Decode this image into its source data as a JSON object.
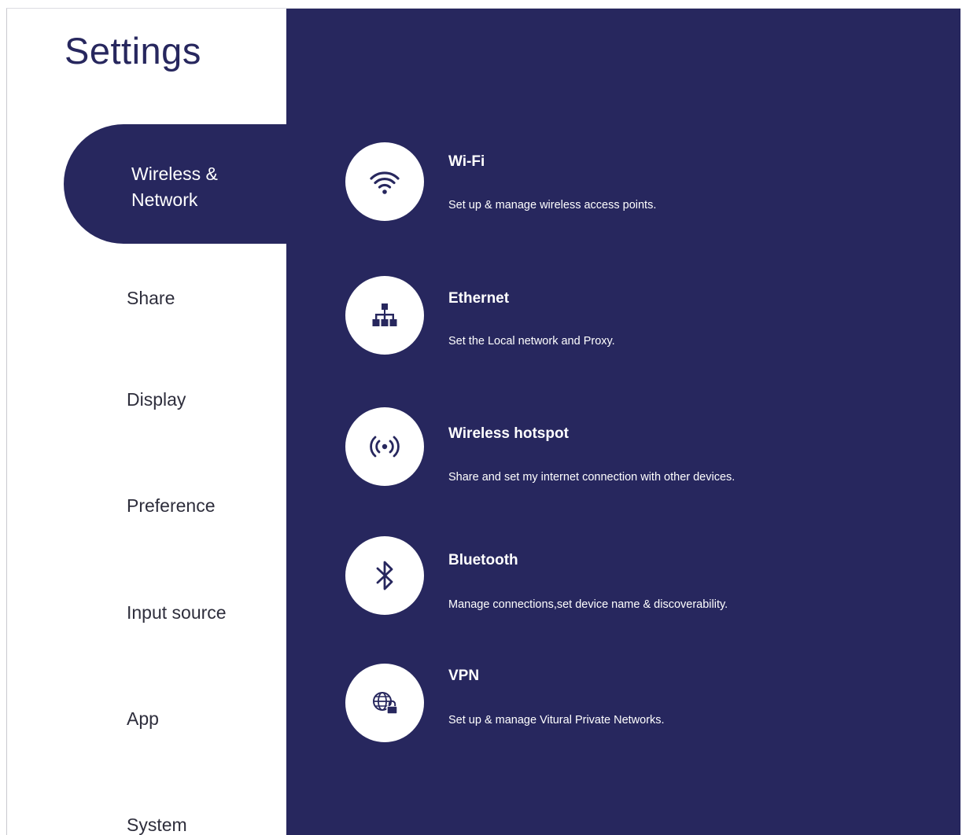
{
  "page": {
    "title": "Settings"
  },
  "sidebar": {
    "active": {
      "label_line1": "Wireless &",
      "label_line2": "Network"
    },
    "items": [
      {
        "label": "Share"
      },
      {
        "label": "Display"
      },
      {
        "label": "Preference"
      },
      {
        "label": "Input source"
      },
      {
        "label": "App"
      },
      {
        "label": "System"
      }
    ]
  },
  "options": [
    {
      "title": "Wi-Fi",
      "description": "Set up & manage wireless access points.",
      "icon": "wifi-icon"
    },
    {
      "title": "Ethernet",
      "description": "Set the Local network and Proxy.",
      "icon": "ethernet-network-icon"
    },
    {
      "title": "Wireless hotspot",
      "description": "Share and set my internet connection with other devices.",
      "icon": "hotspot-icon"
    },
    {
      "title": "Bluetooth",
      "description": "Manage connections,set device name & discoverability.",
      "icon": "bluetooth-icon"
    },
    {
      "title": "VPN",
      "description": "Set up & manage Vitural Private Networks.",
      "icon": "vpn-globe-lock-icon"
    }
  ],
  "colors": {
    "panel": "#27275e",
    "sidebar": "#ffffff",
    "text_dark": "#2e2e3c",
    "text_light": "#ffffff"
  }
}
